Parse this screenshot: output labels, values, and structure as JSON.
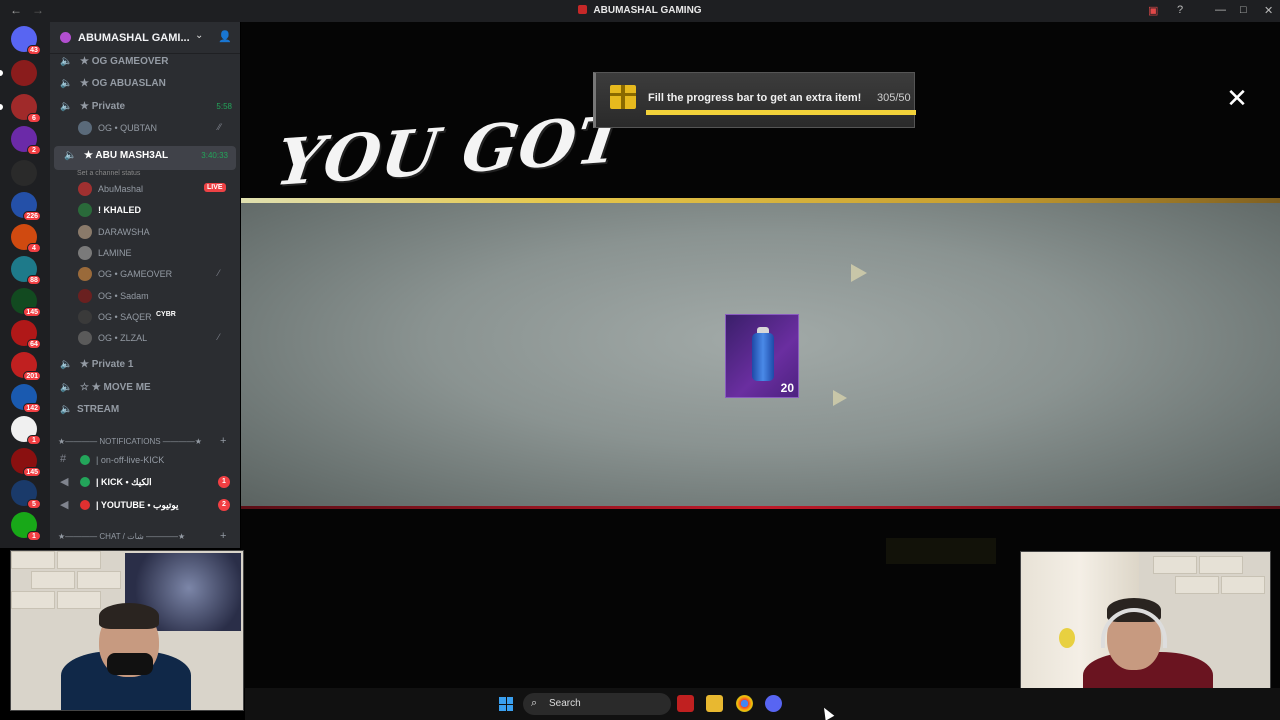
{
  "window": {
    "title": "ABUMASHAL GAMING"
  },
  "server": {
    "name": "ABUMASHAL GAMI..."
  },
  "rail": {
    "badges": [
      "43",
      "6",
      "2",
      "226",
      "4",
      "88",
      "145",
      "64",
      "201",
      "142",
      "1",
      "145",
      "5",
      "1"
    ]
  },
  "voice_channels": [
    {
      "label": "★ OG GAMEOVER",
      "time": ""
    },
    {
      "label": "★ OG ABUASLAN",
      "time": ""
    },
    {
      "label": "★ Private",
      "time": "5:58"
    },
    {
      "label": "OG • QUBTAN",
      "time": ""
    },
    {
      "label": "★ ABU MASH3AL",
      "time": "3:40:33"
    }
  ],
  "channel_status_hint": "Set a channel status",
  "users": [
    {
      "name": "AbuMashal",
      "live": "LIVE"
    },
    {
      "name": "! KHALED"
    },
    {
      "name": "DARAWSHA"
    },
    {
      "name": "LAMINE"
    },
    {
      "name": "OG • GAMEOVER"
    },
    {
      "name": "OG • Sadam"
    },
    {
      "name": "OG • SAQER",
      "tag": "CYBR"
    },
    {
      "name": "OG • ZLZAL"
    }
  ],
  "more_channels": [
    {
      "label": "★ Private 1"
    },
    {
      "label": "☆ ★ MOVE ME"
    },
    {
      "label": "STREAM"
    }
  ],
  "categories": {
    "notifications": "★———— NOTIFICATIONS ————★",
    "chat": "★———— CHAT / شات ————★"
  },
  "notify_channels": [
    {
      "label": "| on-off-live-KICK",
      "count": ""
    },
    {
      "label": "| KICK • الكيك",
      "count": "1"
    },
    {
      "label": "| YOUTUBE • يوتيوب",
      "count": "2"
    }
  ],
  "game": {
    "headline": "YOU GOT",
    "progress_text": "Fill the progress bar to get an extra item!",
    "progress_count": "305/50",
    "progress_fraction": 1.0,
    "item_quantity": "20",
    "close_icon": "close-icon"
  },
  "taskbar": {
    "search_label": "Search"
  },
  "colors": {
    "discord_bg": "#2b2d31",
    "rail_bg": "#1e1f22",
    "live_red": "#ed4245",
    "progress_yellow": "#f2d23a",
    "item_purple": "#6a2ea0"
  }
}
